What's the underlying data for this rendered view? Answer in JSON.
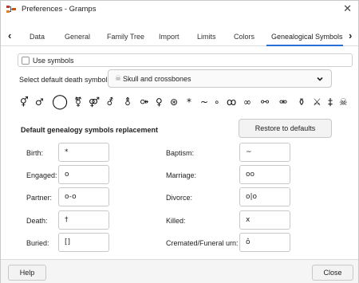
{
  "window": {
    "title": "Preferences - Gramps",
    "close_glyph": "✕",
    "app_icon": "gramps-tree-icon"
  },
  "tabs": {
    "left_arrow": "‹",
    "right_arrow": "›",
    "items": [
      {
        "label": "Data"
      },
      {
        "label": "General"
      },
      {
        "label": "Family Tree"
      },
      {
        "label": "Import"
      },
      {
        "label": "Limits"
      },
      {
        "label": "Colors"
      },
      {
        "label": "Genealogical Symbols"
      }
    ],
    "active": "Genealogical Symbols",
    "accent_color": "#2a6fd6"
  },
  "use_symbols": {
    "label": "Use symbols",
    "checked": false
  },
  "death_symbol": {
    "label": "Select default death symbol:",
    "icon": "☠",
    "value": "Skull and crossbones"
  },
  "symbols": [
    "⚥",
    "♂",
    "◯",
    "⚧",
    "⚤",
    "⚦",
    "⚨",
    "⚩",
    "♀",
    "⊛",
    "*",
    "~",
    "∘",
    "ꝏ",
    "∞",
    "⚯",
    "⚮",
    "⚱",
    "⚔",
    "‡",
    "☠"
  ],
  "replacement": {
    "title": "Default genealogy symbols replacement",
    "restore_label": "Restore to defaults",
    "left": [
      {
        "label": "Birth:",
        "value": "*"
      },
      {
        "label": "Engaged:",
        "value": "o"
      },
      {
        "label": "Partner:",
        "value": "o-o"
      },
      {
        "label": "Death:",
        "value": "†"
      },
      {
        "label": "Buried:",
        "value": "[]"
      }
    ],
    "right": [
      {
        "label": "Baptism:",
        "value": "~"
      },
      {
        "label": "Marriage:",
        "value": "oo"
      },
      {
        "label": "Divorce:",
        "value": "o|o"
      },
      {
        "label": "Killed:",
        "value": "x"
      },
      {
        "label": "Cremated/Funeral urn:",
        "value": "ô"
      }
    ]
  },
  "footer": {
    "help_label": "Help",
    "close_label": "Close"
  }
}
